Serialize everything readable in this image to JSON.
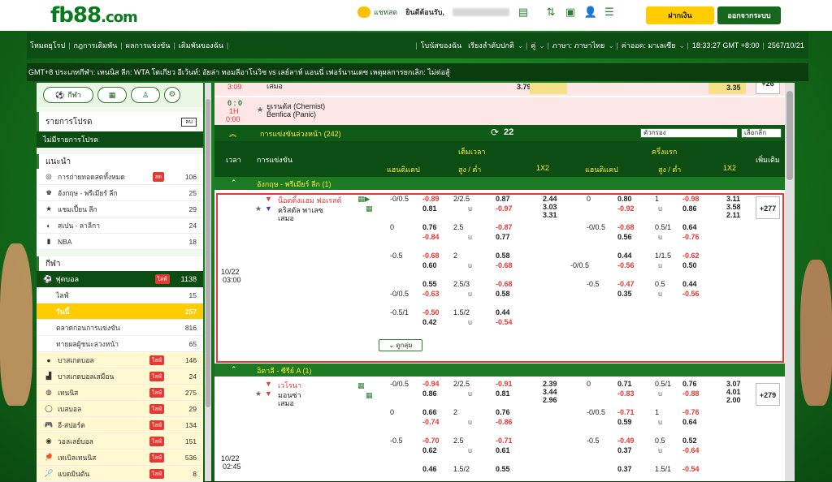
{
  "header": {
    "logo_main": "fb88",
    "logo_suffix": ".com",
    "chat_label": "แชทสด",
    "welcome": "ยินดีต้อนรับ,",
    "balance": "",
    "deposit": "ฝากเงิน",
    "logout": "ออกจากระบบ"
  },
  "nav": [
    "โหมดยุโรป",
    "กฎการเดิมพัน",
    "ผลการแข่งขัน",
    "เดิมพันของฉัน",
    "โบนัสของฉัน",
    "เรียงลำดับปกติ",
    "คู่",
    "ภาษา: ภาษาไทย",
    "ค่าออด: มาเลเซีย",
    "18:33:27 GMT +8:00",
    "2567/10/21"
  ],
  "ticker": "GMT+8 ประเภทกีฬา: เทนนิส ลีก: WTA โตเกียว อีเว้นท์: อัยล่า ทอมลีอาโนวิช vs เลย์ลาห์ แอนนี่ เฟอร์นานเดซ เหตุผลการยกเลิก: ไม่ต่อสู้",
  "sidebar": {
    "sport_tab": "กีฬา",
    "fav_title": "รายการโปรด",
    "fav_btn": "ลบ",
    "fav_empty": "ไม่มีรายการโปรด",
    "rec_title": "แนะนำ",
    "rec": [
      {
        "name": "การถ่ายทอดสดทั้งหมด",
        "badge": "สด",
        "count": "106"
      },
      {
        "name": "อังกฤษ - พรีเมียร์ ลีก",
        "count": "25"
      },
      {
        "name": "แชมเปี้ยน ลีก",
        "count": "29"
      },
      {
        "name": "สเปน - ลาลีกา",
        "count": "24"
      },
      {
        "name": "NBA",
        "count": "18"
      }
    ],
    "sports_title": "กีฬา",
    "football": {
      "name": "ฟุตบอล",
      "badge": "ไลฟ์",
      "count": "1138"
    },
    "sub": [
      {
        "name": "ไลฟ์",
        "count": "15"
      },
      {
        "name": "วันนี้",
        "count": "257"
      },
      {
        "name": "ตลาดก่อนการแข่งขัน",
        "count": "816"
      },
      {
        "name": "ทายผลผู้ชนะล่วงหน้า",
        "count": "65"
      }
    ],
    "sports": [
      {
        "name": "บาสเกตบอล",
        "badge": "ไลฟ์",
        "count": "146"
      },
      {
        "name": "บาสเกตบอลเสมือน",
        "badge": "ไลฟ์",
        "count": "24"
      },
      {
        "name": "เทนนิส",
        "badge": "ไลฟ์",
        "count": "275"
      },
      {
        "name": "เบสบอล",
        "badge": "ไลฟ์",
        "count": "29"
      },
      {
        "name": "อี-สปอร์ต",
        "badge": "ไลฟ์",
        "count": "134"
      },
      {
        "name": "วอลเลย์บอล",
        "badge": "ไลฟ์",
        "count": "151"
      },
      {
        "name": "เทเบิลเทนนิส",
        "badge": "ไลฟ์",
        "count": "536"
      },
      {
        "name": "แบดมินตัน",
        "badge": "ไลฟ์",
        "count": "8"
      }
    ]
  },
  "live_top": {
    "time": "3:09",
    "draw": "เสมอ",
    "odd1": "3.79",
    "odd2": "",
    "odd3": "3.35",
    "plus": "+26"
  },
  "live_row": {
    "score": "0 : 0",
    "half": "1H",
    "minute": "0:00",
    "home": "ยูเรนดัส (Chemist)",
    "away": "Benfica (Panic)"
  },
  "upcoming": {
    "title": "การแข่งขันล่วงหน้า (242)",
    "refresh": "22",
    "filter": "ตัวกรอง",
    "select": "เลือกลีก"
  },
  "cols": {
    "time": "เวลา",
    "event": "การแข่งขัน",
    "fulltime": "เต็มเวลา",
    "firsthalf": "ครึ่งแรก",
    "hdp": "แฮนดิแคป",
    "ou": "สูง / ต่ำ",
    "x12": "1X2",
    "more": "เพิ่มเติม"
  },
  "league1": {
    "name": "อังกฤษ - พรีเมียร์ ลีก (1)"
  },
  "match1": {
    "date": "10/22",
    "time": "03:00",
    "home": "น็อตติ้งแฮม ฟอเรสต์",
    "away": "คริสตัล พาเลซ",
    "draw": "เสมอ",
    "plus": "+277",
    "more": "ดูกลุ่ม",
    "lines": [
      {
        "fh": "-0/0.5",
        "fa": "",
        "f1": "-0.89",
        "f2": "0.81",
        "ou": "2/2.5",
        "u": "u",
        "o1": "0.87",
        "o2": "-0.97",
        "x1": "2.44",
        "x2": "3.03",
        "x3": "3.31",
        "hh": "0",
        "hh2": "",
        "h1": "0.80",
        "h2": "-0.92",
        "hou": "1",
        "hu": "u",
        "ho1": "-0.98",
        "ho2": "0.86",
        "hx1": "3.11",
        "hx2": "3.58",
        "hx3": "2.11"
      },
      {
        "fh": "0",
        "fa": "",
        "f1": "0.76",
        "f2": "-0.84",
        "ou": "2.5",
        "u": "u",
        "o1": "-0.87",
        "o2": "0.77",
        "hh": "-0/0.5",
        "hh2": "",
        "h1": "-0.68",
        "h2": "0.56",
        "hou": "0.5/1",
        "hu": "u",
        "ho1": "0.64",
        "ho2": "-0.76"
      },
      {
        "fh": "-0.5",
        "fa": "",
        "f1": "-0.68",
        "f2": "0.60",
        "ou": "2",
        "u": "u",
        "o1": "0.58",
        "o2": "-0.68",
        "hh": "",
        "hh2": "-0/0.5",
        "h1": "0.44",
        "h2": "-0.56",
        "hou": "1/1.5",
        "hu": "u",
        "ho1": "-0.62",
        "ho2": "0.50"
      },
      {
        "fh": "",
        "fa": "-0/0.5",
        "f1": "0.55",
        "f2": "-0.63",
        "ou": "2.5/3",
        "u": "u",
        "o1": "-0.68",
        "o2": "0.58",
        "hh": "-0.5",
        "hh2": "",
        "h1": "-0.47",
        "h2": "0.35",
        "hou": "0.5",
        "hu": "u",
        "ho1": "0.44",
        "ho2": "-0.56"
      },
      {
        "fh": "-0.5/1",
        "fa": "",
        "f1": "-0.50",
        "f2": "0.42",
        "ou": "1.5/2",
        "u": "u",
        "o1": "0.44",
        "o2": "-0.54"
      }
    ]
  },
  "league2": {
    "name": "อิตาลี - ซีรีย์ A (1)"
  },
  "match2": {
    "date": "10/22",
    "time": "02:45",
    "home": "เวโรนา",
    "away": "มอนซ่า",
    "draw": "เสมอ",
    "plus": "+279",
    "lines": [
      {
        "fh": "-0/0.5",
        "fa": "",
        "f1": "-0.94",
        "f2": "0.86",
        "ou": "2/2.5",
        "u": "u",
        "o1": "-0.91",
        "o2": "0.81",
        "x1": "2.39",
        "x2": "3.44",
        "x3": "2.96",
        "hh": "0",
        "hh2": "",
        "h1": "0.71",
        "h2": "-0.83",
        "hou": "0.5/1",
        "hu": "u",
        "ho1": "0.76",
        "ho2": "-0.88",
        "hx1": "3.07",
        "hx2": "4.01",
        "hx3": "2.00"
      },
      {
        "fh": "0",
        "fa": "",
        "f1": "0.66",
        "f2": "-0.74",
        "ou": "2",
        "u": "u",
        "o1": "0.76",
        "o2": "-0.86",
        "hh": "-0/0.5",
        "hh2": "",
        "h1": "-0.71",
        "h2": "0.59",
        "hou": "1",
        "hu": "u",
        "ho1": "-0.76",
        "ho2": "0.64"
      },
      {
        "fh": "-0.5",
        "fa": "",
        "f1": "-0.70",
        "f2": "0.62",
        "ou": "2.5",
        "u": "u",
        "o1": "-0.71",
        "o2": "0.61",
        "hh": "-0.5",
        "hh2": "",
        "h1": "-0.49",
        "h2": "0.37",
        "hou": "0.5",
        "hu": "u",
        "ho1": "0.52",
        "ho2": "-0.64"
      },
      {
        "fh": "",
        "fa": "",
        "f1": "0.46",
        "f2": "",
        "ou": "1.5/2",
        "u": "",
        "o1": "0.55",
        "o2": "",
        "hh": "",
        "hh2": "",
        "h1": "0.37",
        "h2": "",
        "hou": "1.5/1",
        "hu": "",
        "ho1": "-0.54",
        "ho2": ""
      }
    ]
  }
}
